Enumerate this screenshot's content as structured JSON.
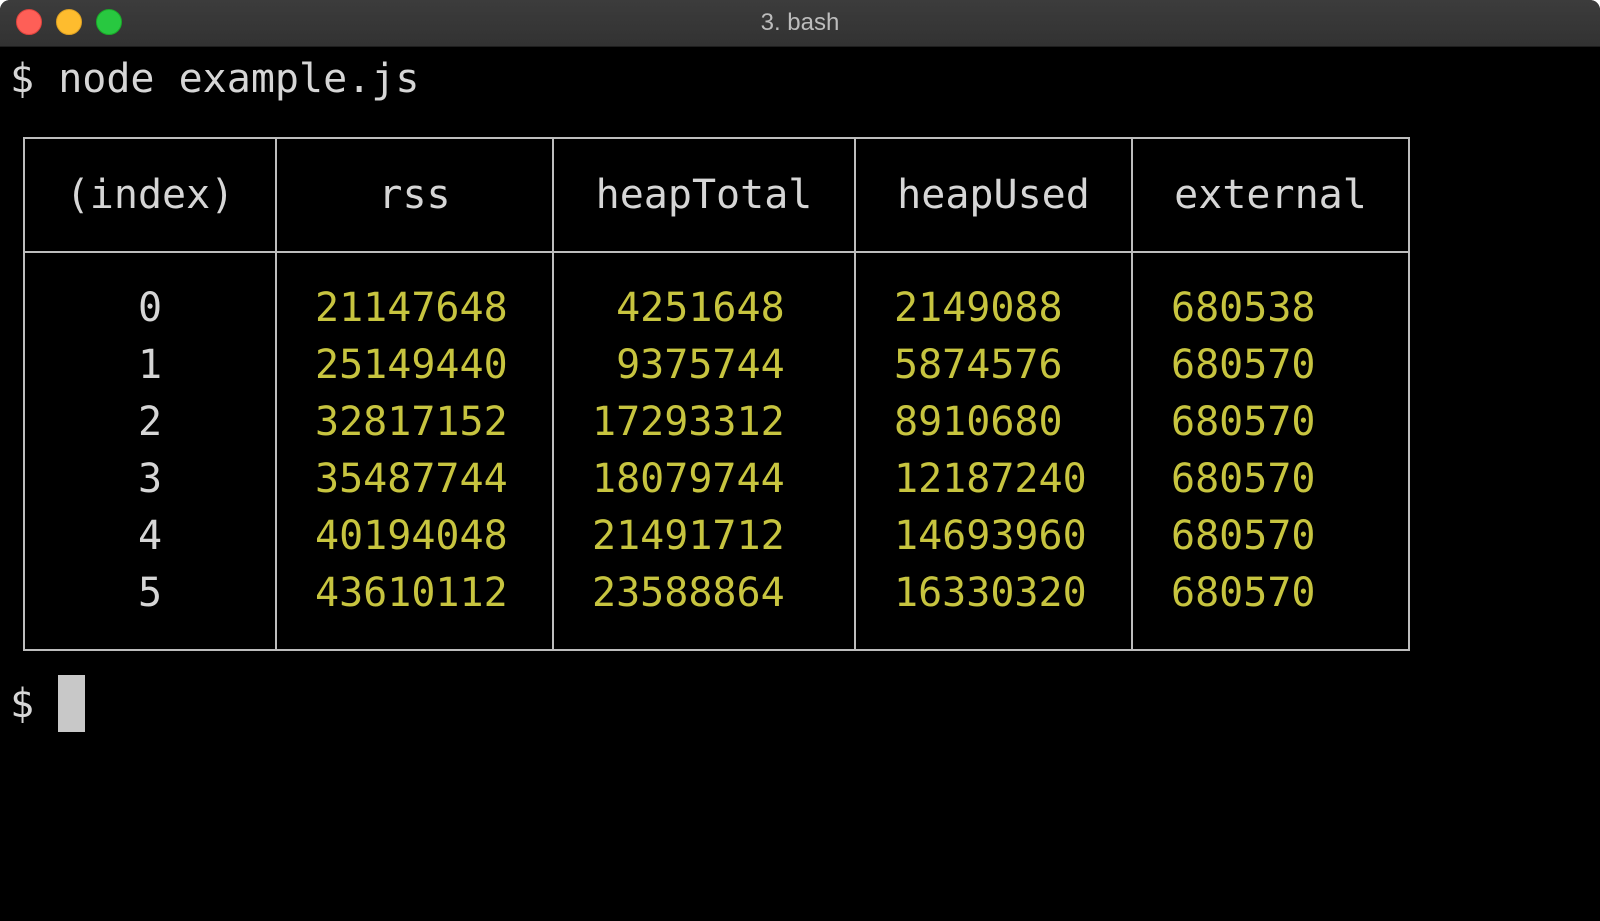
{
  "window": {
    "title": "3. bash"
  },
  "terminal": {
    "prompt": "$",
    "command": "node example.js"
  },
  "table": {
    "headers": [
      "(index)",
      "rss",
      "heapTotal",
      "heapUsed",
      "external"
    ],
    "rows": [
      [
        "0",
        "21147648",
        " 4251648",
        "2149088",
        "680538"
      ],
      [
        "1",
        "25149440",
        " 9375744",
        "5874576",
        "680570"
      ],
      [
        "2",
        "32817152",
        "17293312",
        "8910680",
        "680570"
      ],
      [
        "3",
        "35487744",
        "18079744",
        "12187240",
        "680570"
      ],
      [
        "4",
        "40194048",
        "21491712",
        "14693960",
        "680570"
      ],
      [
        "5",
        "43610112",
        "23588864",
        "16330320",
        "680570"
      ]
    ]
  },
  "colors": {
    "background": "#000000",
    "text": "#d6d6d6",
    "numbers": "#c7c43f",
    "cursor": "#c8c8c8"
  }
}
